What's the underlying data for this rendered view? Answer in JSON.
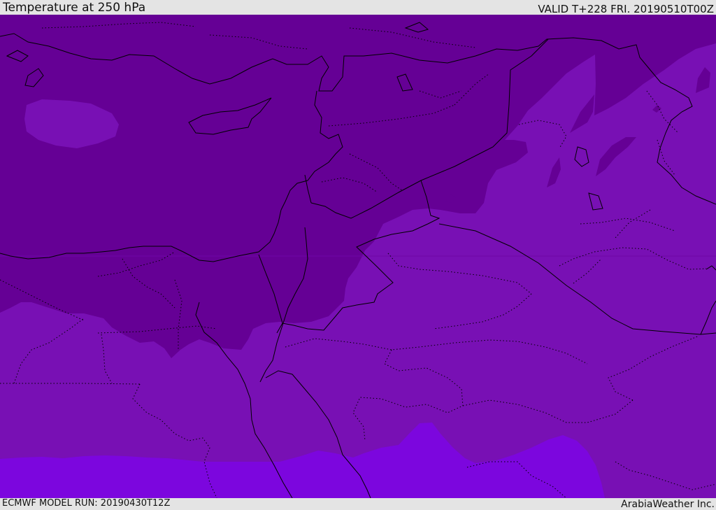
{
  "header": {
    "title": "Temperature at 250 hPa",
    "valid": "VALID T+228 FRI. 20190510T00Z"
  },
  "footer": {
    "model_run": "ECMWF MODEL RUN: 20190430T12Z",
    "credit": "ArabiaWeather Inc."
  },
  "map": {
    "field": "temperature",
    "level": "250 hPa",
    "colors": {
      "coldest_band": "#650095",
      "middle_band": "#7810b4",
      "warmest_band": "#7c06de",
      "coastline": "#000000",
      "border": "#000000"
    }
  }
}
